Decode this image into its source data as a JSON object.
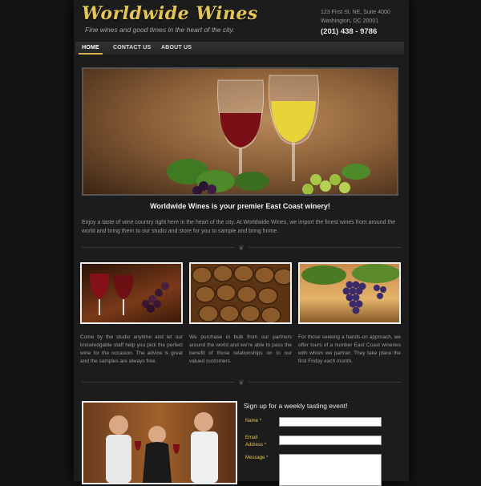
{
  "header": {
    "logo": "Worldwide Wines",
    "tagline": "Fine wines and good times in the heart of the city.",
    "address_line1": "123 First St. NE, Suite 4000",
    "address_line2": "Washington, DC 20001",
    "phone": "(201) 438 - 9786"
  },
  "nav": {
    "items": [
      {
        "label": "HOME"
      },
      {
        "label": "CONTACT US"
      },
      {
        "label": "ABOUT US"
      }
    ],
    "active": "HOME"
  },
  "main": {
    "headline": "Worldwide Wines is your premier East Coast winery!",
    "intro": "Enjoy a taste of wine country right here in the heart of the city. At Worldwide Wines, we import the finest wines from around the world and bring them to our studio and store for you to sample and bring home.",
    "columns": [
      {
        "text": "Come by the studio anytime and let our knowledgable staff help you pick the perfect wine for the occasion. The advice is great and the samples are always free."
      },
      {
        "text": "We purchase in bulk from our partners around the world and we're able to pass the benefit of those relationships on to our valued customers."
      },
      {
        "text": "For those seeking a hands-on approach, we offer tours of a number East Coast wineries with whom we partner. They take place the first Friday each month."
      }
    ]
  },
  "signup": {
    "title": "Sign up for a weekly tasting event!",
    "name_label": "Name",
    "email_label": "Email Address",
    "message_label": "Message",
    "required_mark": "*"
  },
  "colors": {
    "accent": "#e3c55a",
    "background": "#141414"
  }
}
